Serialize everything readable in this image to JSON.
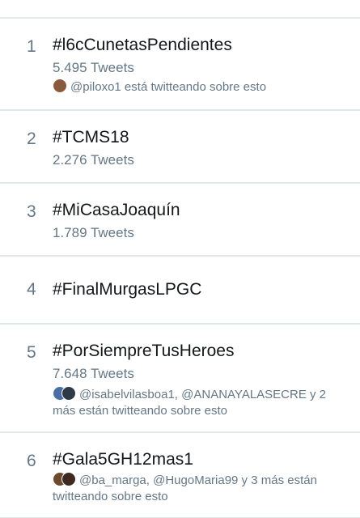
{
  "trends": [
    {
      "rank": "1",
      "tag": "#l6cCunetasPendientes",
      "count": "5.495 Tweets",
      "context": "@piloxo1 está twitteando sobre esto",
      "avatar_colors": [
        "#8a5a3c"
      ]
    },
    {
      "rank": "2",
      "tag": "#TCMS18",
      "count": "2.276 Tweets",
      "context": "",
      "avatar_colors": []
    },
    {
      "rank": "3",
      "tag": "#MiCasaJoaquín",
      "count": "1.789 Tweets",
      "context": "",
      "avatar_colors": []
    },
    {
      "rank": "4",
      "tag": "#FinalMurgasLPGC",
      "count": "",
      "context": "",
      "avatar_colors": []
    },
    {
      "rank": "5",
      "tag": "#PorSiempreTusHeroes",
      "count": "7.648 Tweets",
      "context": "@isabelvilasboa1, @ANANAYALASECRE y 2 más están twitteando sobre esto",
      "avatar_colors": [
        "#4a6fa5",
        "#2e3a48"
      ]
    },
    {
      "rank": "6",
      "tag": "#Gala5GH12mas1",
      "count": "",
      "context": "@ba_marga, @HugoMaria99 y 3 más están twitteando sobre esto",
      "avatar_colors": [
        "#6b4a2e",
        "#3d2b1f"
      ]
    }
  ]
}
